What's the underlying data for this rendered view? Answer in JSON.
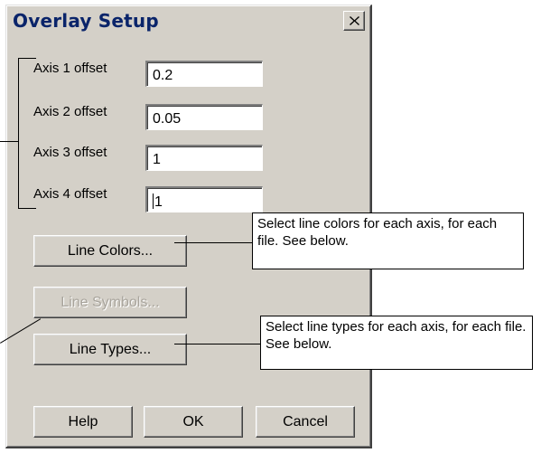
{
  "dialog": {
    "title": "Overlay Setup",
    "close_icon": "close-x-icon"
  },
  "fields": [
    {
      "label": "Axis 1 offset",
      "value": "0.2"
    },
    {
      "label": "Axis 2 offset",
      "value": "0.05"
    },
    {
      "label": "Axis 3 offset",
      "value": "1"
    },
    {
      "label": "Axis 4 offset",
      "value": "1"
    }
  ],
  "buttons": {
    "line_colors": "Line Colors...",
    "line_symbols": "Line Symbols...",
    "line_types": "Line Types...",
    "help": "Help",
    "ok": "OK",
    "cancel": "Cancel"
  },
  "callouts": {
    "line_colors": "Select line colors for each axis, for each file. See below.",
    "line_types": "Select line types for each axis, for each file. See below."
  },
  "colors": {
    "dialog_face": "#d4d0c8",
    "title_text": "#0a246a",
    "disabled_text": "#a8a49c"
  }
}
